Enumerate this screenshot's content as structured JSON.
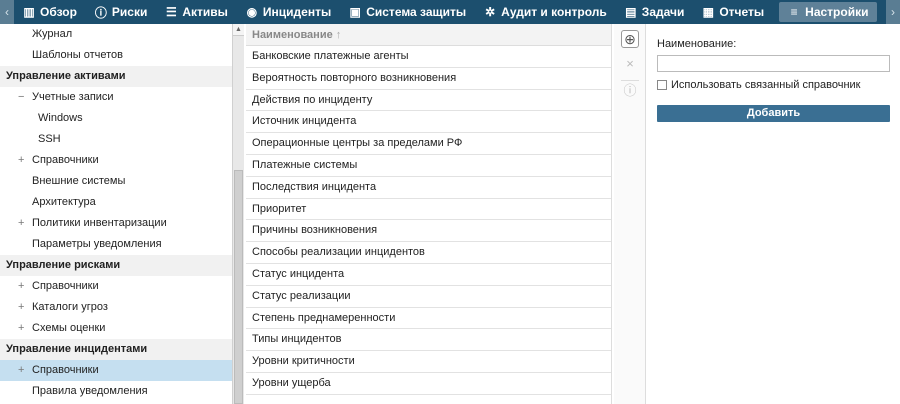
{
  "nav": {
    "items": [
      {
        "label": "Обзор",
        "icon": "bar-chart-icon"
      },
      {
        "label": "Риски",
        "icon": "alert-circle-icon"
      },
      {
        "label": "Активы",
        "icon": "database-icon"
      },
      {
        "label": "Инциденты",
        "icon": "target-icon"
      },
      {
        "label": "Система защиты",
        "icon": "shield-icon"
      },
      {
        "label": "Аудит и контроль",
        "icon": "cog-icon"
      },
      {
        "label": "Задачи",
        "icon": "tasks-icon"
      },
      {
        "label": "Отчеты",
        "icon": "report-icon"
      },
      {
        "label": "Настройки",
        "icon": "menu-icon"
      }
    ]
  },
  "sidebar": {
    "rows": [
      {
        "label": "Журнал",
        "level": "l1",
        "toggle": ""
      },
      {
        "label": "Шаблоны отчетов",
        "level": "l1",
        "toggle": ""
      },
      {
        "label": "Управление активами",
        "level": "section",
        "toggle": ""
      },
      {
        "label": "Учетные записи",
        "level": "l1",
        "toggle": "−"
      },
      {
        "label": "Windows",
        "level": "l2",
        "toggle": ""
      },
      {
        "label": "SSH",
        "level": "l2",
        "toggle": ""
      },
      {
        "label": "Справочники",
        "level": "l1",
        "toggle": "+"
      },
      {
        "label": "Внешние системы",
        "level": "l1",
        "toggle": ""
      },
      {
        "label": "Архитектура",
        "level": "l1",
        "toggle": ""
      },
      {
        "label": "Политики инвентаризации",
        "level": "l1",
        "toggle": "+"
      },
      {
        "label": "Параметры уведомления",
        "level": "l1",
        "toggle": ""
      },
      {
        "label": "Управление рисками",
        "level": "section",
        "toggle": ""
      },
      {
        "label": "Справочники",
        "level": "l1",
        "toggle": "+"
      },
      {
        "label": "Каталоги угроз",
        "level": "l1",
        "toggle": "+"
      },
      {
        "label": "Схемы оценки",
        "level": "l1",
        "toggle": "+"
      },
      {
        "label": "Управление инцидентами",
        "level": "section",
        "toggle": ""
      },
      {
        "label": "Справочники",
        "level": "l1",
        "toggle": "+",
        "selected": true
      },
      {
        "label": "Правила уведомления",
        "level": "l1",
        "toggle": ""
      }
    ]
  },
  "list": {
    "header": "Наименование",
    "sort_glyph": "↑",
    "rows": [
      "Банковские платежные агенты",
      "Вероятность повторного возникновения",
      "Действия по инциденту",
      "Источник инцидента",
      "Операционные центры за пределами РФ",
      "Платежные системы",
      "Последствия инцидента",
      "Приоритет",
      "Причины возникновения",
      "Способы реализации инцидентов",
      "Статус инцидента",
      "Статус реализации",
      "Степень преднамеренности",
      "Типы инцидентов",
      "Уровни критичности",
      "Уровни ущерба"
    ]
  },
  "toolbar": {
    "add_icon": "⊕",
    "delete_icon": "×",
    "info_icon": "ⓘ"
  },
  "form": {
    "name_label": "Наименование:",
    "name_value": "",
    "linked_label": "Использовать связанный справочник",
    "submit_label": "Добавить"
  }
}
